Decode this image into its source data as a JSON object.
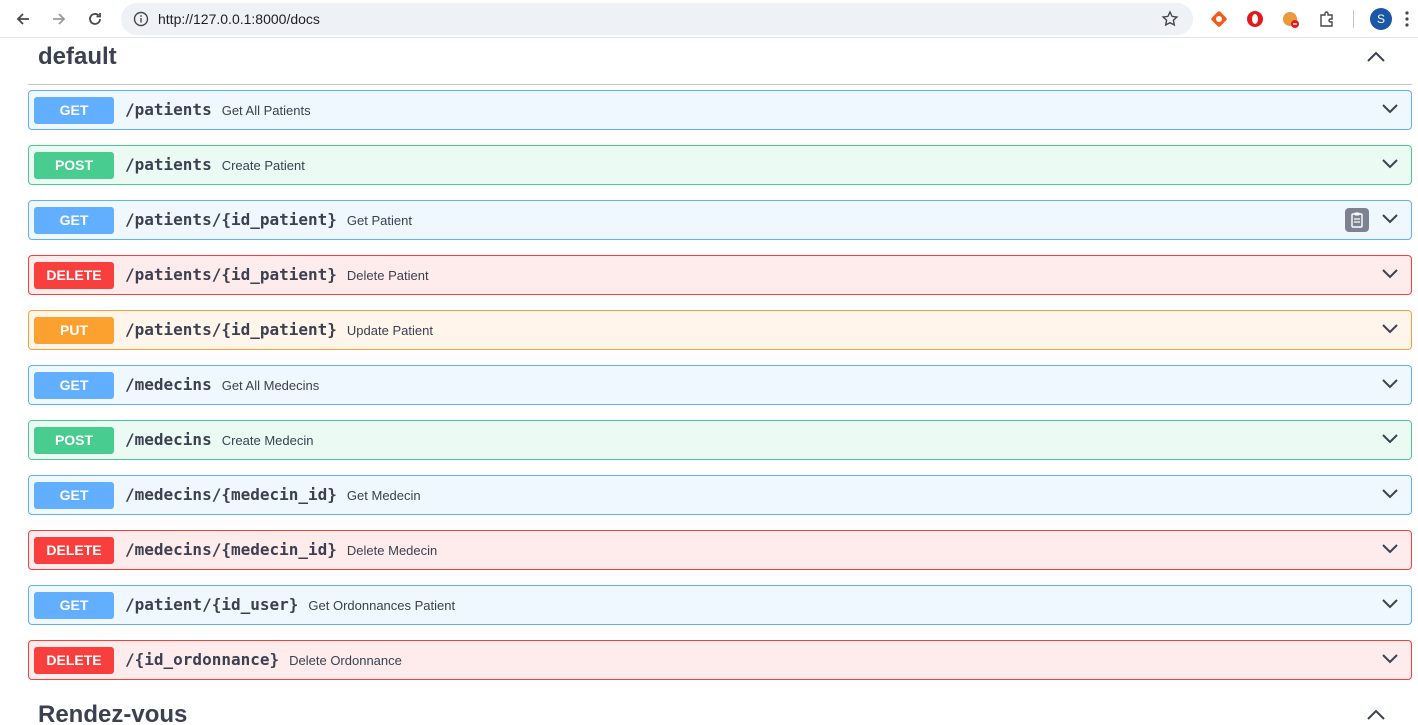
{
  "browser": {
    "url": "http://127.0.0.1:8000/docs",
    "profile_initial": "S"
  },
  "sections": [
    {
      "title": "default"
    },
    {
      "title": "Rendez-vous"
    }
  ],
  "operations": [
    {
      "method": "GET",
      "path": "/patients",
      "summary": "Get All Patients"
    },
    {
      "method": "POST",
      "path": "/patients",
      "summary": "Create Patient"
    },
    {
      "method": "GET",
      "path": "/patients/{id_patient}",
      "summary": "Get Patient"
    },
    {
      "method": "DELETE",
      "path": "/patients/{id_patient}",
      "summary": "Delete Patient"
    },
    {
      "method": "PUT",
      "path": "/patients/{id_patient}",
      "summary": "Update Patient"
    },
    {
      "method": "GET",
      "path": "/medecins",
      "summary": "Get All Medecins"
    },
    {
      "method": "POST",
      "path": "/medecins",
      "summary": "Create Medecin"
    },
    {
      "method": "GET",
      "path": "/medecins/{medecin_id}",
      "summary": "Get Medecin"
    },
    {
      "method": "DELETE",
      "path": "/medecins/{medecin_id}",
      "summary": "Delete Medecin"
    },
    {
      "method": "GET",
      "path": "/patient/{id_user}",
      "summary": "Get Ordonnances Patient"
    },
    {
      "method": "DELETE",
      "path": "/{id_ordonnance}",
      "summary": "Delete Ordonnance"
    }
  ],
  "colors": {
    "get": "#61affe",
    "post": "#49cc90",
    "delete": "#f93e3e",
    "put": "#fca130"
  }
}
